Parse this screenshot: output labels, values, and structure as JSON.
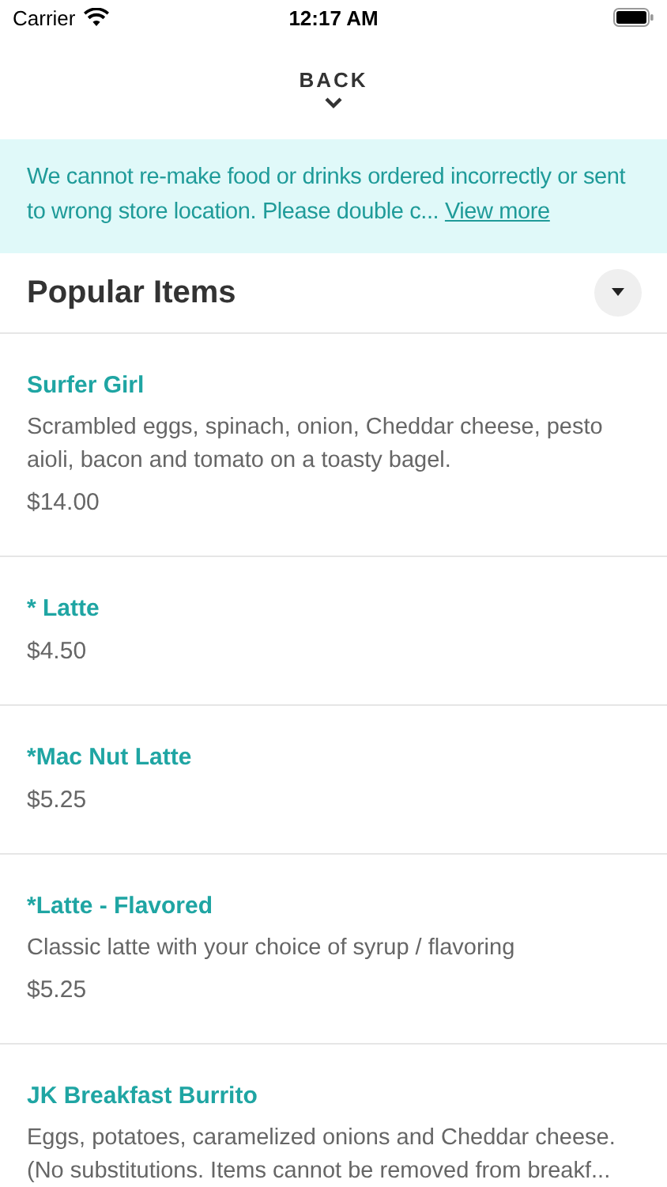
{
  "status_bar": {
    "carrier": "Carrier",
    "time": "12:17 AM"
  },
  "back": {
    "label": "BACK"
  },
  "notice": {
    "text": "We cannot re-make food or drinks ordered incorrectly or sent to wrong store location. Please double c...",
    "link": "View more"
  },
  "section": {
    "title": "Popular Items"
  },
  "items": [
    {
      "name": "Surfer Girl",
      "description": "Scrambled eggs, spinach, onion, Cheddar cheese, pesto aioli, bacon and tomato on a toasty bagel.",
      "price": "$14.00"
    },
    {
      "name": "* Latte",
      "price": "$4.50"
    },
    {
      "name": "*Mac Nut Latte",
      "price": "$5.25"
    },
    {
      "name": "*Latte - Flavored",
      "description": "Classic latte with your choice of syrup / flavoring",
      "price": "$5.25"
    },
    {
      "name": "JK Breakfast Burrito",
      "description": "Eggs, potatoes, caramelized onions and Cheddar cheese. (No substitutions. Items cannot be removed from breakf..."
    }
  ]
}
